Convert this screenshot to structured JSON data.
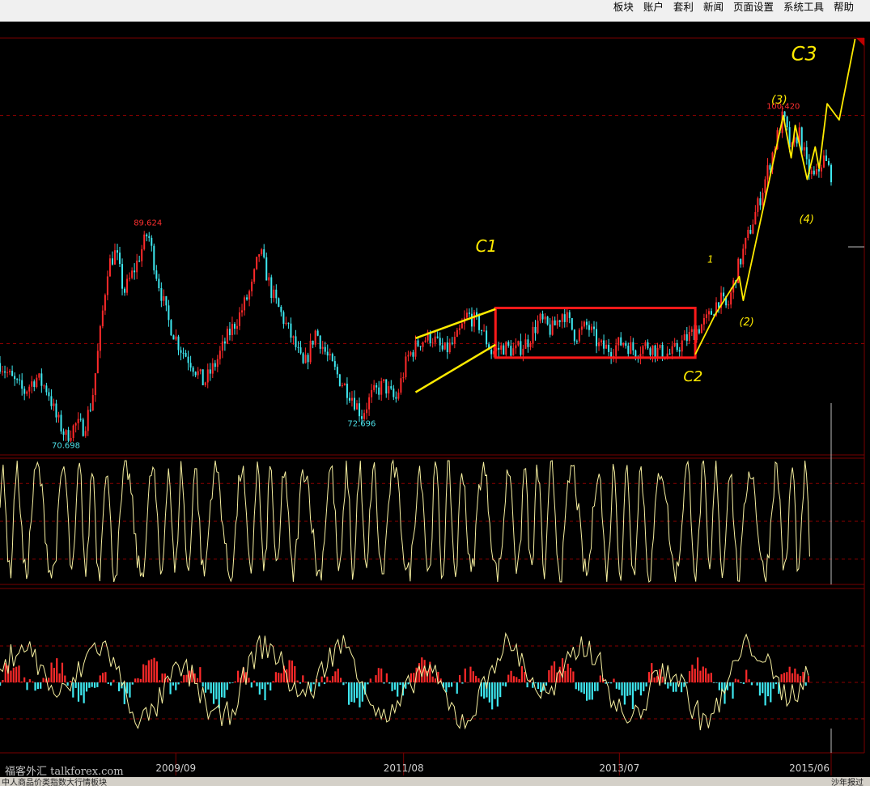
{
  "menu": [
    "板块",
    "账户",
    "套利",
    "新闻",
    "页面设置",
    "系统工具",
    "帮助"
  ],
  "chart_data": {
    "type": "line",
    "x_ticks": [
      "2009/09",
      "2011/08",
      "2013/07",
      "2015/06"
    ],
    "price": {
      "series": [
        {
          "t": 0,
          "v": 77.5
        },
        {
          "t": 3,
          "v": 76.0
        },
        {
          "t": 6,
          "v": 74.8
        },
        {
          "t": 9,
          "v": 76.2
        },
        {
          "t": 12,
          "v": 75.0
        },
        {
          "t": 14,
          "v": 72.5
        },
        {
          "t": 16.5,
          "v": 70.698
        },
        {
          "t": 19,
          "v": 71.8
        },
        {
          "t": 21,
          "v": 71.5
        },
        {
          "t": 23,
          "v": 74.0
        },
        {
          "t": 25,
          "v": 80.0
        },
        {
          "t": 27,
          "v": 86.5
        },
        {
          "t": 29,
          "v": 87.8
        },
        {
          "t": 31,
          "v": 84.0
        },
        {
          "t": 34,
          "v": 86.5
        },
        {
          "t": 37,
          "v": 89.624
        },
        {
          "t": 39,
          "v": 86.0
        },
        {
          "t": 42,
          "v": 81.5
        },
        {
          "t": 45,
          "v": 79.0
        },
        {
          "t": 48,
          "v": 77.5
        },
        {
          "t": 51,
          "v": 75.6
        },
        {
          "t": 54,
          "v": 77.5
        },
        {
          "t": 57,
          "v": 80.0
        },
        {
          "t": 60,
          "v": 82.0
        },
        {
          "t": 63,
          "v": 84.5
        },
        {
          "t": 65,
          "v": 88.0
        },
        {
          "t": 68,
          "v": 84.0
        },
        {
          "t": 71,
          "v": 81.5
        },
        {
          "t": 74,
          "v": 79.0
        },
        {
          "t": 76,
          "v": 77.0
        },
        {
          "t": 79,
          "v": 80.5
        },
        {
          "t": 82,
          "v": 78.0
        },
        {
          "t": 85,
          "v": 76.0
        },
        {
          "t": 88,
          "v": 74.5
        },
        {
          "t": 90.5,
          "v": 72.696
        },
        {
          "t": 93,
          "v": 74.5
        },
        {
          "t": 96,
          "v": 75.5
        },
        {
          "t": 99,
          "v": 74.0
        },
        {
          "t": 102,
          "v": 78.0
        },
        {
          "t": 105,
          "v": 79.5
        },
        {
          "t": 108,
          "v": 80.0
        },
        {
          "t": 111,
          "v": 78.5
        },
        {
          "t": 114,
          "v": 79.5
        },
        {
          "t": 117,
          "v": 82.0
        },
        {
          "t": 120,
          "v": 81.0
        },
        {
          "t": 123,
          "v": 78.5
        },
        {
          "t": 126,
          "v": 79.0
        },
        {
          "t": 129,
          "v": 78.6
        },
        {
          "t": 132,
          "v": 79.5
        },
        {
          "t": 135,
          "v": 81.5
        },
        {
          "t": 138,
          "v": 80.5
        },
        {
          "t": 141,
          "v": 82.3
        },
        {
          "t": 144,
          "v": 80.0
        },
        {
          "t": 147,
          "v": 81.0
        },
        {
          "t": 150,
          "v": 79.0
        },
        {
          "t": 153,
          "v": 78.8
        },
        {
          "t": 156,
          "v": 79.5
        },
        {
          "t": 159,
          "v": 78.6
        },
        {
          "t": 162,
          "v": 79.2
        },
        {
          "t": 165,
          "v": 78.5
        },
        {
          "t": 168,
          "v": 78.3
        },
        {
          "t": 171,
          "v": 79.5
        },
        {
          "t": 174,
          "v": 80.5
        },
        {
          "t": 177,
          "v": 81.5
        },
        {
          "t": 180,
          "v": 83.5
        },
        {
          "t": 182,
          "v": 82.5
        },
        {
          "t": 184,
          "v": 85.5
        },
        {
          "t": 187,
          "v": 89.0
        },
        {
          "t": 190,
          "v": 92.5
        },
        {
          "t": 193,
          "v": 96.5
        },
        {
          "t": 196,
          "v": 100.42
        },
        {
          "t": 198,
          "v": 97.0
        },
        {
          "t": 200,
          "v": 99.0
        },
        {
          "t": 202,
          "v": 95.5
        },
        {
          "t": 204,
          "v": 94.5
        },
        {
          "t": 206,
          "v": 96.5
        },
        {
          "t": 208,
          "v": 95.0
        }
      ],
      "extreme_labels": [
        {
          "t": 16.5,
          "v": 70.698,
          "text": "70.698",
          "pos": "below",
          "color": "#4de0e8"
        },
        {
          "t": 37,
          "v": 89.624,
          "text": "89.624",
          "pos": "above",
          "color": "#ff3030"
        },
        {
          "t": 90.5,
          "v": 72.696,
          "text": "72.696",
          "pos": "below",
          "color": "#4de0e8"
        },
        {
          "t": 196,
          "v": 100.42,
          "text": "100.420",
          "pos": "above",
          "color": "#ff3030"
        }
      ],
      "ylim": [
        69.0,
        107.5
      ]
    },
    "oscillator": {
      "ylim": [
        0,
        100
      ],
      "levels": [
        20,
        50,
        80
      ]
    },
    "macd": {
      "ylim": [
        -1,
        1
      ]
    },
    "annotations": {
      "labels": [
        "C1",
        "C2",
        "C3",
        "1",
        "(2)",
        "(3)",
        "(4)"
      ],
      "box": {
        "t_start": 124,
        "t_end": 174,
        "v_low": 78.0,
        "v_high": 82.6
      },
      "wedge_upper": [
        [
          104,
          79.8
        ],
        [
          124,
          82.5
        ]
      ],
      "wedge_lower": [
        [
          104,
          74.8
        ],
        [
          124,
          79.2
        ]
      ]
    },
    "colors": {
      "up": "#ff2a2a",
      "down": "#3ee8f0",
      "oscillator": "#f7f0a0",
      "annotation": "#ffeb00",
      "box": "#ff1a1a",
      "divider": "#7a0000"
    }
  },
  "watermark": "福客外汇 talkforex.com",
  "status_left": "中人商品价类指数大行情板块",
  "status_right": "沙年报过"
}
